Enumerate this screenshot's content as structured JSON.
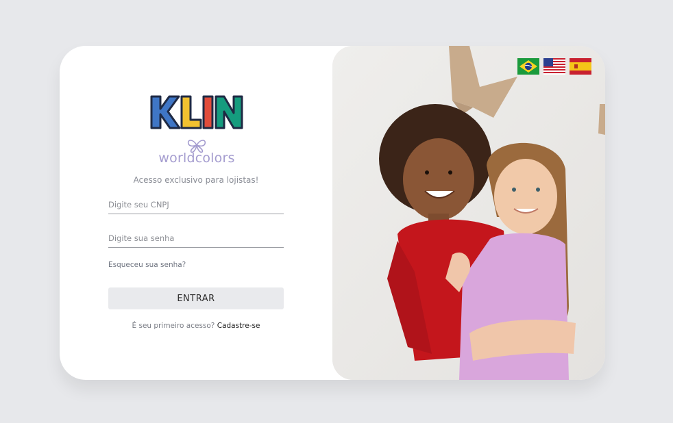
{
  "brand": {
    "primary_logo": "KLIN",
    "secondary_logo": "worldcolors",
    "colors": {
      "k": "#3f76c6",
      "l": "#f2c230",
      "i": "#e14c3b",
      "n": "#159c7e",
      "wc": "#a49ccf"
    }
  },
  "login": {
    "tagline": "Acesso exclusivo para lojistas!",
    "cnpj_placeholder": "Digite seu CNPJ",
    "password_placeholder": "Digite sua senha",
    "forgot_label": "Esqueceu sua senha?",
    "submit_label": "ENTRAR",
    "first_access_text": "É seu primeiro acesso?",
    "signup_link": "Cadastre-se"
  },
  "languages": [
    {
      "code": "pt-BR",
      "icon": "brazil-flag-icon"
    },
    {
      "code": "en-US",
      "icon": "usa-flag-icon"
    },
    {
      "code": "es",
      "icon": "spain-flag-icon"
    }
  ]
}
